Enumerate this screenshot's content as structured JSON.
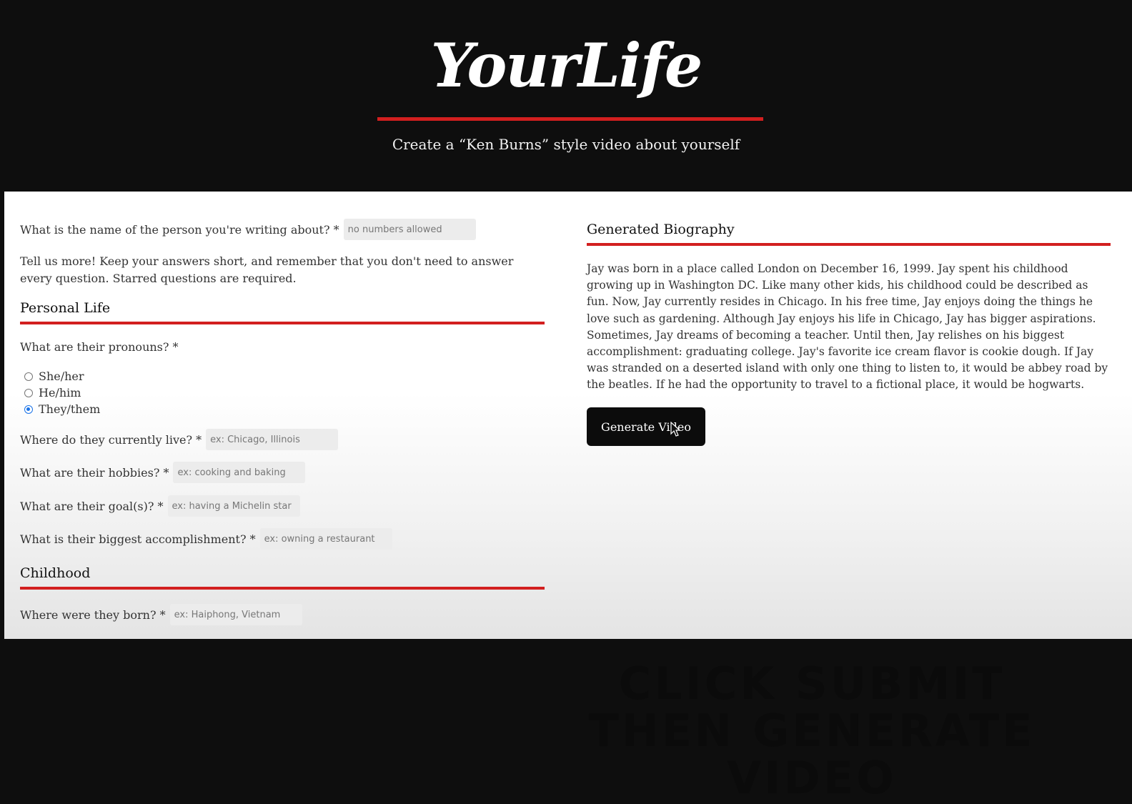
{
  "header": {
    "logo": "YourLife",
    "tagline": "Create a “Ken Burns” style video about yourself"
  },
  "form": {
    "name_question": "What is the name of the person you're writing about? *",
    "name_placeholder": "no numbers allowed",
    "intro": "Tell us more! Keep your answers short, and remember that you don't need to answer every question. Starred questions are required.",
    "sections": {
      "personal_life": "Personal Life",
      "childhood": "Childhood"
    },
    "pronouns": {
      "question": "What are their pronouns? *",
      "options": [
        "She/her",
        "He/him",
        "They/them"
      ],
      "selected": "They/them"
    },
    "live": {
      "label": "Where do they currently live? *",
      "placeholder": "ex: Chicago, Illinois"
    },
    "hobbies": {
      "label": "What are their hobbies? *",
      "placeholder": "ex: cooking and baking"
    },
    "goals": {
      "label": "What are their goal(s)? *",
      "placeholder": "ex: having a Michelin star"
    },
    "accomplishment": {
      "label": "What is their biggest accomplishment? *",
      "placeholder": "ex: owning a restaurant"
    },
    "born": {
      "label": "Where were they born? *",
      "placeholder": "ex: Haiphong, Vietnam"
    }
  },
  "biography": {
    "title": "Generated Biography",
    "text": "Jay was born in a place called London on December 16, 1999. Jay spent his childhood growing up in Washington DC. Like many other kids, his childhood could be described as fun. Now, Jay currently resides in Chicago. In his free time, Jay enjoys doing the things he love such as gardening. Although Jay enjoys his life in Chicago, Jay has bigger aspirations. Sometimes, Jay dreams of becoming a teacher. Until then, Jay relishes on his biggest accomplishment: graduating college. Jay's favorite ice cream flavor is cookie dough. If Jay was stranded on a deserted island with only one thing to listen to, it would be abbey road by the beatles. If he had the opportunity to travel to a fictional place, it would be hogwarts.",
    "button": "Generate Video"
  },
  "overlay": {
    "line1": "CLICK SUBMIT",
    "line2": "THEN GENERATE VIDEO"
  },
  "colors": {
    "accent": "#d21f1f",
    "header_bg": "#0e0e0e",
    "radio_selected": "#1a73e8"
  }
}
